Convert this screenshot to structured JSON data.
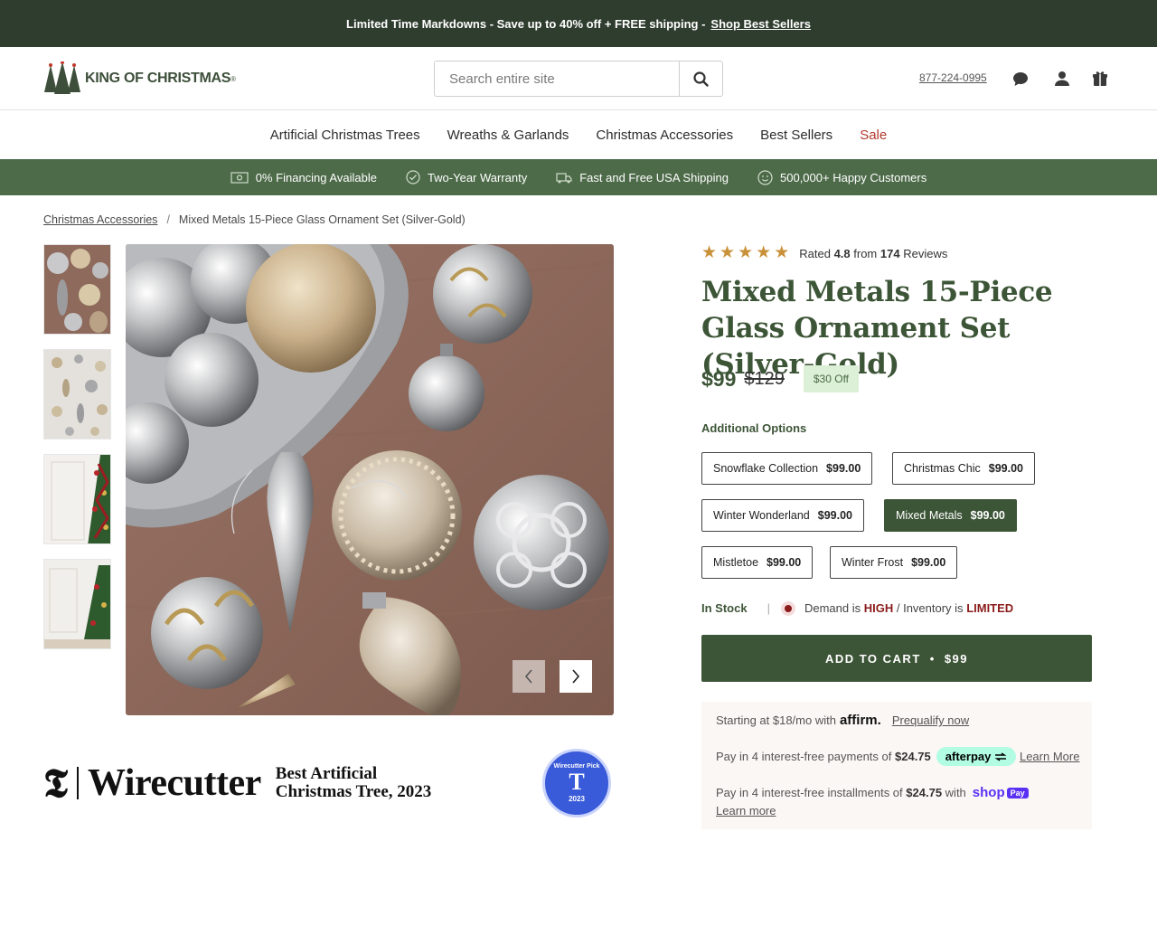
{
  "promo": {
    "text": "Limited Time Markdowns - Save up to 40% off + FREE shipping - ",
    "link": "Shop Best Sellers"
  },
  "header": {
    "logo_text": "KING OF CHRISTMAS",
    "logo_mark": "®",
    "search_placeholder": "Search entire site",
    "phone": "877-224-0995",
    "icons": [
      "chat-icon",
      "account-icon",
      "cart-icon"
    ]
  },
  "nav": {
    "items": [
      "Artificial Christmas Trees",
      "Wreaths & Garlands",
      "Christmas Accessories",
      "Best Sellers",
      "Sale"
    ]
  },
  "benefits": [
    "0% Financing Available",
    "Two-Year Warranty",
    "Fast and Free USA Shipping",
    "500,000+ Happy Customers"
  ],
  "breadcrumb": {
    "parent": "Christmas Accessories",
    "separator": "/",
    "current": "Mixed Metals 15-Piece Glass Ornament Set (Silver-Gold)"
  },
  "product": {
    "rating_prefix": "Rated",
    "rating": "4.8",
    "rating_from": "from",
    "review_count": "174",
    "reviews_label": "Reviews",
    "stars": 4.8,
    "title": "Mixed Metals 15-Piece Glass Ornament Set (Silver-Gold)",
    "price": "$99",
    "was_price": "$129",
    "discount": "$30 Off",
    "options_label": "Additional Options",
    "options": [
      {
        "name": "Snowflake Collection",
        "price": "$99.00",
        "selected": false
      },
      {
        "name": "Christmas Chic",
        "price": "$99.00",
        "selected": false
      },
      {
        "name": "Winter Wonderland",
        "price": "$99.00",
        "selected": false
      },
      {
        "name": "Mixed Metals",
        "price": "$99.00",
        "selected": true
      },
      {
        "name": "Mistletoe",
        "price": "$99.00",
        "selected": false
      },
      {
        "name": "Winter Frost",
        "price": "$99.00",
        "selected": false
      }
    ],
    "stock": "In Stock",
    "stock_sep": "|",
    "demand_prefix": "Demand is",
    "demand": "HIGH",
    "inventory_prefix": "/ Inventory is",
    "inventory": "LIMITED",
    "add_to_cart": "ADD TO CART",
    "cart_bullet": "•",
    "cart_price": "$99"
  },
  "payments": {
    "affirm_text": "Starting at $18/mo with",
    "affirm_logo": "affirm.",
    "affirm_link": "Prequalify now",
    "afterpay_text": "Pay in 4 interest-free payments of",
    "afterpay_amount": "$24.75",
    "afterpay_logo": "afterpay",
    "afterpay_link": "Learn More",
    "shop_text": "Pay in 4 interest-free installments of",
    "shop_amount": "$24.75",
    "shop_with": "with",
    "shop_logo": "shop",
    "shop_pay": "Pay",
    "shop_link": "Learn more"
  },
  "gallery": {
    "thumbnails": [
      "ornament-set-closeup",
      "ornament-set-flatlay",
      "decorated-tree-room",
      "decorated-tree-wall"
    ],
    "main": "ornament-set-closeup"
  },
  "award": {
    "logo_letter": "𝕿",
    "name": "Wirecutter",
    "title_line1": "Best Artificial",
    "title_line2": "Christmas Tree, 2023",
    "badge_top": "Wirecutter Pick",
    "badge_letter": "T",
    "badge_year": "2023"
  }
}
